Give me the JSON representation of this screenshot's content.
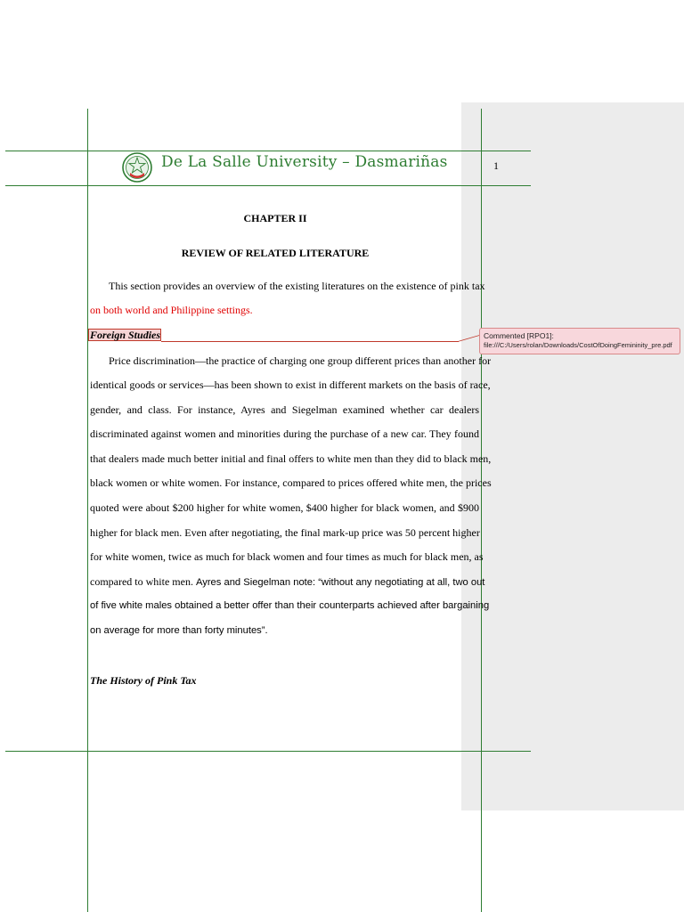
{
  "header": {
    "university": "De La Salle University – Dasmariñas",
    "page_number": "1"
  },
  "document": {
    "chapter": "CHAPTER II",
    "title": "REVIEW OF RELATED LITERATURE",
    "intro_line1": "This section provides an overview of the existing literatures on the existence of pink tax",
    "intro_line2": "on both world and Philippine settings.",
    "section1_heading": "Foreign Studies",
    "para_lines": [
      "Price discrimination—the practice of charging one group different prices than another for",
      "identical goods or services—has been shown to exist in different markets on the basis of race,",
      "gender, and class. For instance, Ayres and Siegelman examined whether car dealers",
      "discriminated against women and minorities during the purchase of a new car. They found",
      "that dealers made much better initial and final offers to white men than they did to black men,",
      "black women or white women. For instance, compared to prices offered white men, the prices",
      "quoted were about $200 higher for white women, $400 higher for black women, and $900",
      "higher for black men. Even after negotiating, the final mark-up price was 50 percent higher",
      "for white women, twice as much for black women and four times as much for black men, as"
    ],
    "quote_line1_a": "compared to white men. ",
    "quote_line1_b": "Ayres and Siegelman note: “without any negotiating at all, two out",
    "quote_line2": "of five white males obtained a better offer than their counterparts achieved after bargaining",
    "quote_line3": "on average for more than forty minutes”.",
    "section2_heading": "The History of Pink Tax"
  },
  "comment": {
    "tag": "Commented [RPO1]:",
    "text": "file:///C:/Users/rolan/Downloads/CostOfDoingFemininity_pre.pdf"
  }
}
